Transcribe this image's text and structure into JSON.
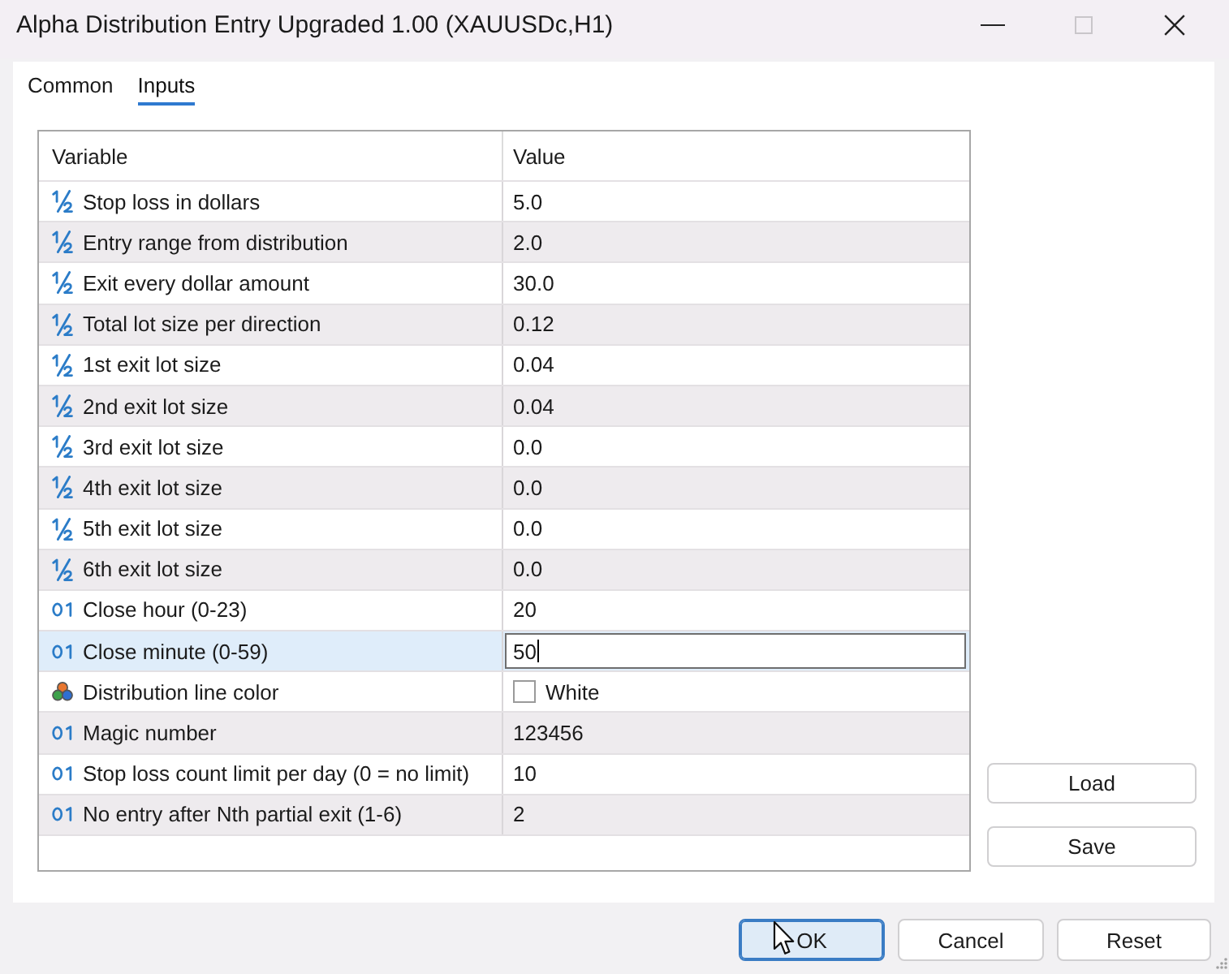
{
  "window": {
    "title": "Alpha Distribution Entry Upgraded 1.00 (XAUUSDc,H1)",
    "controls": [
      {
        "kind": "minimize",
        "disabled": false
      },
      {
        "kind": "maximize",
        "disabled": true
      },
      {
        "kind": "close",
        "disabled": false
      }
    ]
  },
  "tabs": [
    {
      "label": "Common",
      "selected": false
    },
    {
      "label": "Inputs",
      "selected": true
    }
  ],
  "table": {
    "columns": [
      "Variable",
      "Value"
    ],
    "rows": [
      {
        "kind": "double",
        "variable": "Stop loss in dollars",
        "value": "5.0",
        "selected": false
      },
      {
        "kind": "double",
        "variable": "Entry range from distribution",
        "value": "2.0",
        "selected": false
      },
      {
        "kind": "double",
        "variable": "Exit every dollar amount",
        "value": "30.0",
        "selected": false
      },
      {
        "kind": "double",
        "variable": "Total lot size per direction",
        "value": "0.12",
        "selected": false
      },
      {
        "kind": "double",
        "variable": "1st exit lot size",
        "value": "0.04",
        "selected": false
      },
      {
        "kind": "double",
        "variable": "2nd exit lot size",
        "value": "0.04",
        "selected": false
      },
      {
        "kind": "double",
        "variable": "3rd exit lot size",
        "value": "0.0",
        "selected": false
      },
      {
        "kind": "double",
        "variable": "4th exit lot size",
        "value": "0.0",
        "selected": false
      },
      {
        "kind": "double",
        "variable": "5th exit lot size",
        "value": "0.0",
        "selected": false
      },
      {
        "kind": "double",
        "variable": "6th exit lot size",
        "value": "0.0",
        "selected": false
      },
      {
        "kind": "integer",
        "variable": "Close hour (0-23)",
        "value": "20",
        "selected": false
      },
      {
        "kind": "integer",
        "variable": "Close minute (0-59)",
        "value": "50",
        "selected": true
      },
      {
        "kind": "color",
        "variable": "Distribution line color",
        "value": "White",
        "color": "#ffffff",
        "selected": false
      },
      {
        "kind": "integer",
        "variable": "Magic number",
        "value": "123456",
        "selected": false
      },
      {
        "kind": "integer",
        "variable": "Stop loss count limit per day (0 = no limit)",
        "value": "10",
        "selected": false
      },
      {
        "kind": "integer",
        "variable": "No entry after Nth partial exit (1-6)",
        "value": "2",
        "selected": false
      }
    ]
  },
  "side_buttons": [
    "Load",
    "Save"
  ],
  "buttons": [
    {
      "label": "OK",
      "default": true
    },
    {
      "label": "Cancel",
      "default": false
    },
    {
      "label": "Reset",
      "default": false
    }
  ]
}
